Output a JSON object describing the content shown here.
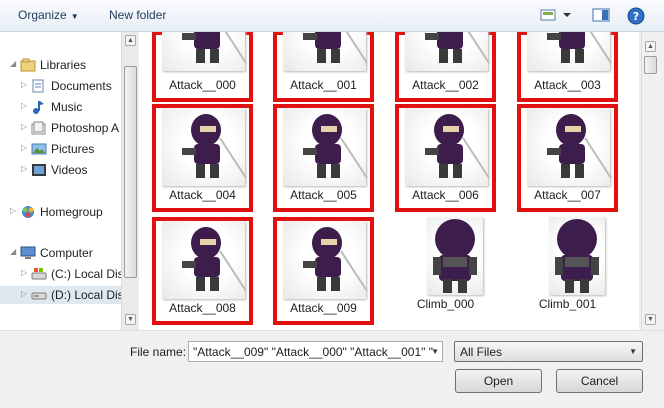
{
  "toolbar": {
    "organize_label": "Organize",
    "new_folder_label": "New folder",
    "view_icon": "view-icon",
    "preview_icon": "preview-pane-icon",
    "help_icon": "help-icon"
  },
  "nav": {
    "items": [
      {
        "label": "Libraries",
        "icon": "libraries-icon"
      },
      {
        "label": "Documents",
        "icon": "documents-icon"
      },
      {
        "label": "Music",
        "icon": "music-icon"
      },
      {
        "label": "Photoshop A",
        "icon": "folder-icon"
      },
      {
        "label": "Pictures",
        "icon": "pictures-icon"
      },
      {
        "label": "Videos",
        "icon": "videos-icon"
      },
      {
        "label": "Homegroup",
        "icon": "homegroup-icon"
      },
      {
        "label": "Computer",
        "icon": "computer-icon"
      },
      {
        "label": "(C:) Local Dis",
        "icon": "drive-icon"
      },
      {
        "label": "(D:) Local Dis",
        "icon": "drive-icon"
      }
    ]
  },
  "files": [
    {
      "name": "Attack__000",
      "selected": true
    },
    {
      "name": "Attack__001",
      "selected": true
    },
    {
      "name": "Attack__002",
      "selected": true
    },
    {
      "name": "Attack__003",
      "selected": true
    },
    {
      "name": "Attack__004",
      "selected": true
    },
    {
      "name": "Attack__005",
      "selected": true
    },
    {
      "name": "Attack__006",
      "selected": true
    },
    {
      "name": "Attack__007",
      "selected": true
    },
    {
      "name": "Attack__008",
      "selected": true
    },
    {
      "name": "Attack__009",
      "selected": true
    },
    {
      "name": "Climb_000",
      "selected": false
    },
    {
      "name": "Climb_001",
      "selected": false
    }
  ],
  "bottom": {
    "file_name_label": "File name:",
    "file_name_value": "\"Attack__009\" \"Attack__000\" \"Attack__001\" \"",
    "filter_value": "All Files",
    "open_label": "Open",
    "cancel_label": "Cancel"
  },
  "colors": {
    "selection_border": "#e31010",
    "ninja_purple": "#3c1d4c"
  }
}
